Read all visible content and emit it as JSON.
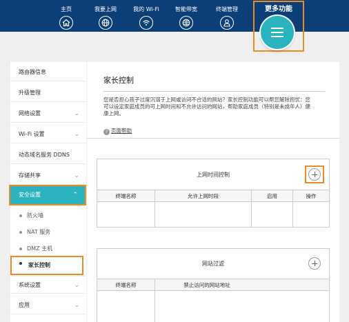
{
  "nav": {
    "items": [
      {
        "label": "主页",
        "icon": "home-icon"
      },
      {
        "label": "我要上网",
        "icon": "globe-icon"
      },
      {
        "label": "我的 Wi-Fi",
        "icon": "wifi-icon"
      },
      {
        "label": "智能带宽",
        "icon": "bandwidth-globe-icon"
      },
      {
        "label": "终端管理",
        "icon": "user-icon"
      }
    ],
    "more_label": "更多功能",
    "colors": {
      "bar": "#0c3f77",
      "accent": "#2bb3bf",
      "highlight": "#f08a22"
    }
  },
  "sidebar": {
    "items": [
      {
        "label": "路由器信息",
        "chevron": false
      },
      {
        "label": "升级管理",
        "chevron": false
      },
      {
        "label": "网络设置",
        "chevron": true
      },
      {
        "label": "Wi-Fi 设置",
        "chevron": true
      },
      {
        "label": "动态域名服务 DDNS",
        "chevron": false
      },
      {
        "label": "存储共享",
        "chevron": true
      },
      {
        "label": "安全设置",
        "chevron": true,
        "active": true
      },
      {
        "label": "系统设置",
        "chevron": true
      },
      {
        "label": "应用",
        "chevron": true
      }
    ],
    "subitems": [
      {
        "label": "防火墙"
      },
      {
        "label": "NAT 服务"
      },
      {
        "label": "DMZ 主机"
      },
      {
        "label": "家长控制",
        "selected": true
      }
    ]
  },
  "main": {
    "title": "家长控制",
    "description": "您是否担心孩子过度沉溺于上网或访问不合适的网站？家长控制功能可以帮您解除担忧：您可以设定家庭成员的可上网时间和不允许访问的网站，帮助家庭成员（特别是未成年人）健康上网。",
    "help_label": "页面帮助",
    "time_panel": {
      "title": "上网时间控制",
      "columns": [
        "终端名称",
        "允许上网时段",
        "启用",
        "操作"
      ]
    },
    "site_panel": {
      "title": "网站过滤",
      "columns": [
        "终端名称",
        "禁止访问的网站地址"
      ]
    }
  }
}
